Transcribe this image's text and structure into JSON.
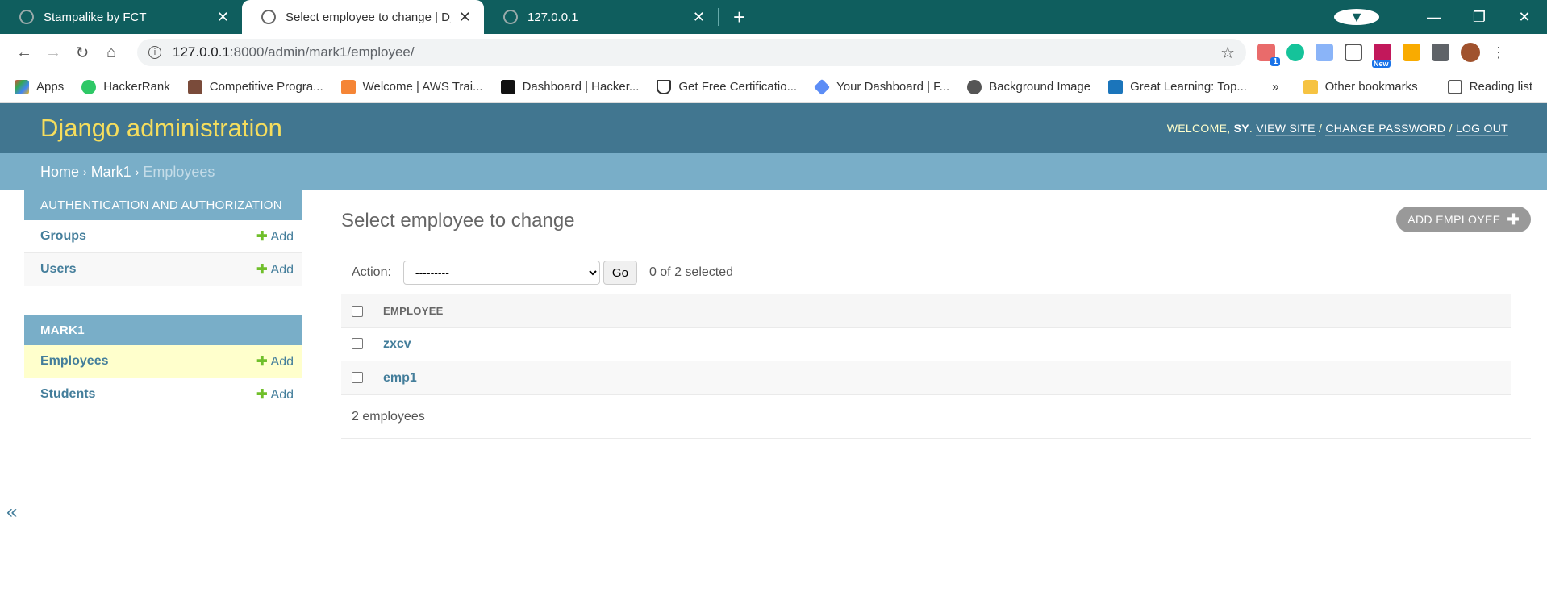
{
  "browser": {
    "tabs": [
      {
        "title": "Stampalike by FCT",
        "active": false
      },
      {
        "title": "Select employee to change | Djar",
        "active": true
      },
      {
        "title": "127.0.0.1",
        "active": false
      }
    ],
    "url_host": "127.0.0.1",
    "url_path": ":8000/admin/mark1/employee/",
    "extension_badge_new": "New",
    "extension_badge_count": "1",
    "bookmarks": [
      {
        "label": "Apps",
        "color": "#e94235"
      },
      {
        "label": "HackerRank",
        "color": "#2ec866"
      },
      {
        "label": "Competitive Progra...",
        "color": "#7a4b3a"
      },
      {
        "label": "Welcome | AWS Trai...",
        "color": "#f58536"
      },
      {
        "label": "Dashboard | Hacker...",
        "color": "#111111"
      },
      {
        "label": "Get Free Certificatio...",
        "color": "#333333"
      },
      {
        "label": "Your Dashboard | F...",
        "color": "#5c8df6"
      },
      {
        "label": "Background Image",
        "color": "#555555"
      },
      {
        "label": "Great Learning: Top...",
        "color": "#1b75bb"
      }
    ],
    "bookmarks_more": "»",
    "other_bookmarks": "Other bookmarks",
    "reading_list": "Reading list"
  },
  "header": {
    "branding": "Django administration",
    "welcome": "Welcome,",
    "user": "SY",
    "view_site": "View site",
    "change_password": "Change password",
    "log_out": "Log out"
  },
  "breadcrumbs": {
    "home": "Home",
    "app": "Mark1",
    "current": "Employees"
  },
  "sidebar": {
    "modules": [
      {
        "caption": "Authentication and Authorization",
        "rows": [
          {
            "name": "Groups",
            "add": "Add"
          },
          {
            "name": "Users",
            "add": "Add"
          }
        ]
      },
      {
        "caption": "Mark1",
        "rows": [
          {
            "name": "Employees",
            "add": "Add"
          },
          {
            "name": "Students",
            "add": "Add"
          }
        ]
      }
    ],
    "toggle": "«"
  },
  "content": {
    "title": "Select employee to change",
    "add_button": "Add Employee",
    "action_label": "Action:",
    "action_value": "---------",
    "go_button": "Go",
    "counter": "0 of 2 selected",
    "column_header": "Employee",
    "rows": [
      "zxcv",
      "emp1"
    ],
    "paginator": "2 employees"
  },
  "colors": {
    "header_bg": "#417690",
    "branding": "#f5dd5d",
    "breadcrumbs_bg": "#79aec8",
    "link": "#447e9b",
    "add_green": "#70bf2b",
    "current_row": "#ffffcc"
  }
}
